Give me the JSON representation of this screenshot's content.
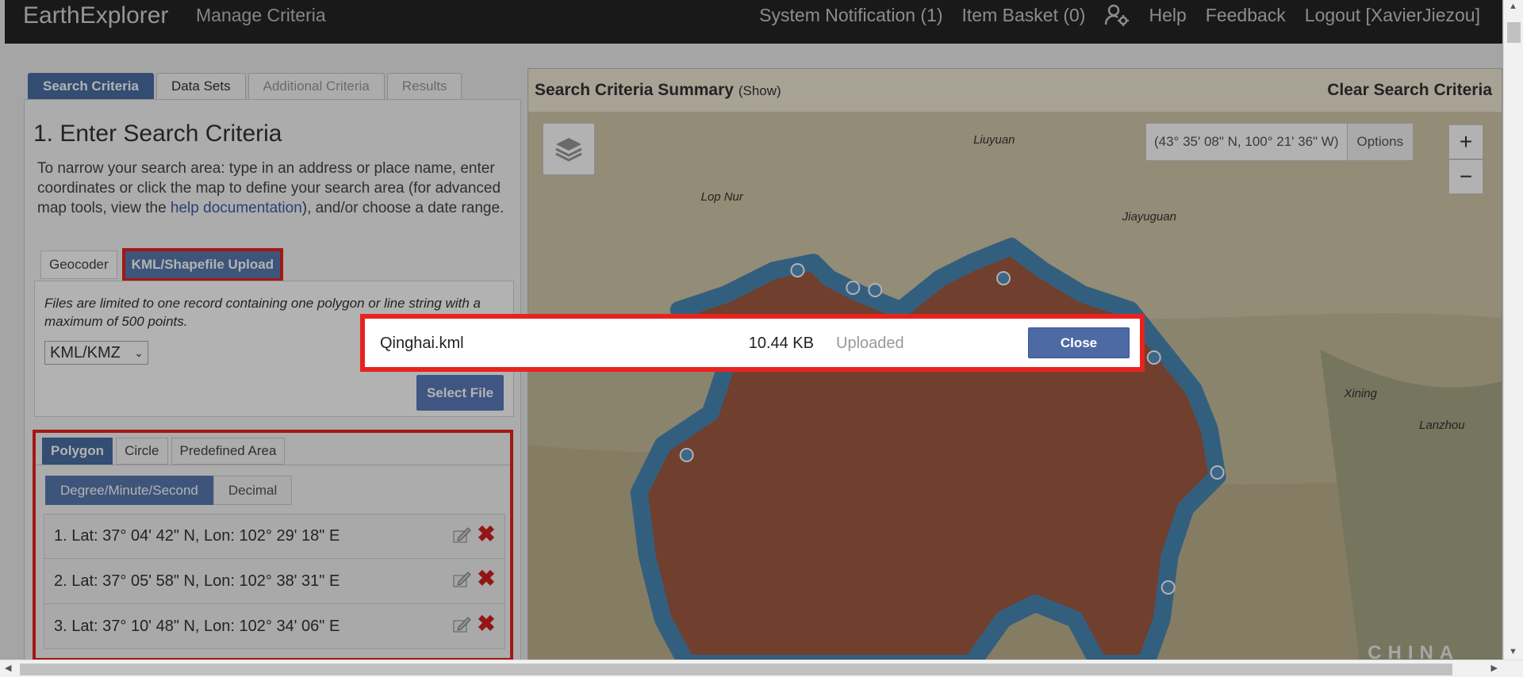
{
  "header": {
    "brand": "EarthExplorer",
    "manage": "Manage Criteria",
    "notification": "System Notification (1)",
    "basket": "Item Basket (0)",
    "help": "Help",
    "feedback": "Feedback",
    "logout": "Logout [XavierJiezou]"
  },
  "main_tabs": [
    "Search Criteria",
    "Data Sets",
    "Additional Criteria",
    "Results"
  ],
  "search": {
    "heading": "1. Enter Search Criteria",
    "intro_pre": "To narrow your search area: type in an address or place name, enter coordinates or click the map to define your search area (for advanced map tools, view the ",
    "intro_link": "help documentation",
    "intro_post": "), and/or choose a date range.",
    "subtabs": [
      "Geocoder",
      "KML/Shapefile Upload"
    ],
    "upload_note": "Files are limited to one record containing one polygon or line string with a maximum of 500 points.",
    "file_type": "KML/KMZ",
    "select_file": "Select File"
  },
  "area": {
    "tabs": [
      "Polygon",
      "Circle",
      "Predefined Area"
    ],
    "formats": [
      "Degree/Minute/Second",
      "Decimal"
    ],
    "coords": [
      "1.  Lat: 37° 04' 42\" N, Lon: 102° 29' 18\" E",
      "2.  Lat: 37° 05' 58\" N, Lon: 102° 38' 31\" E",
      "3.  Lat: 37° 10' 48\" N, Lon: 102° 34' 06\" E"
    ]
  },
  "map": {
    "summary_title": "Search Criteria Summary",
    "summary_show": "(Show)",
    "clear": "Clear Search Criteria",
    "coord_readout": "(43° 35' 08\" N, 100° 21' 36\" W)",
    "options": "Options",
    "zoom_in": "+",
    "zoom_out": "−",
    "places": [
      "Liuyuan",
      "Lop Nur",
      "Jiayuguan",
      "Xining",
      "Lanzhou",
      "CHINA"
    ]
  },
  "dialog": {
    "filename": "Qinghai.kml",
    "size": "10.44 KB",
    "status": "Uploaded",
    "close": "Close"
  }
}
